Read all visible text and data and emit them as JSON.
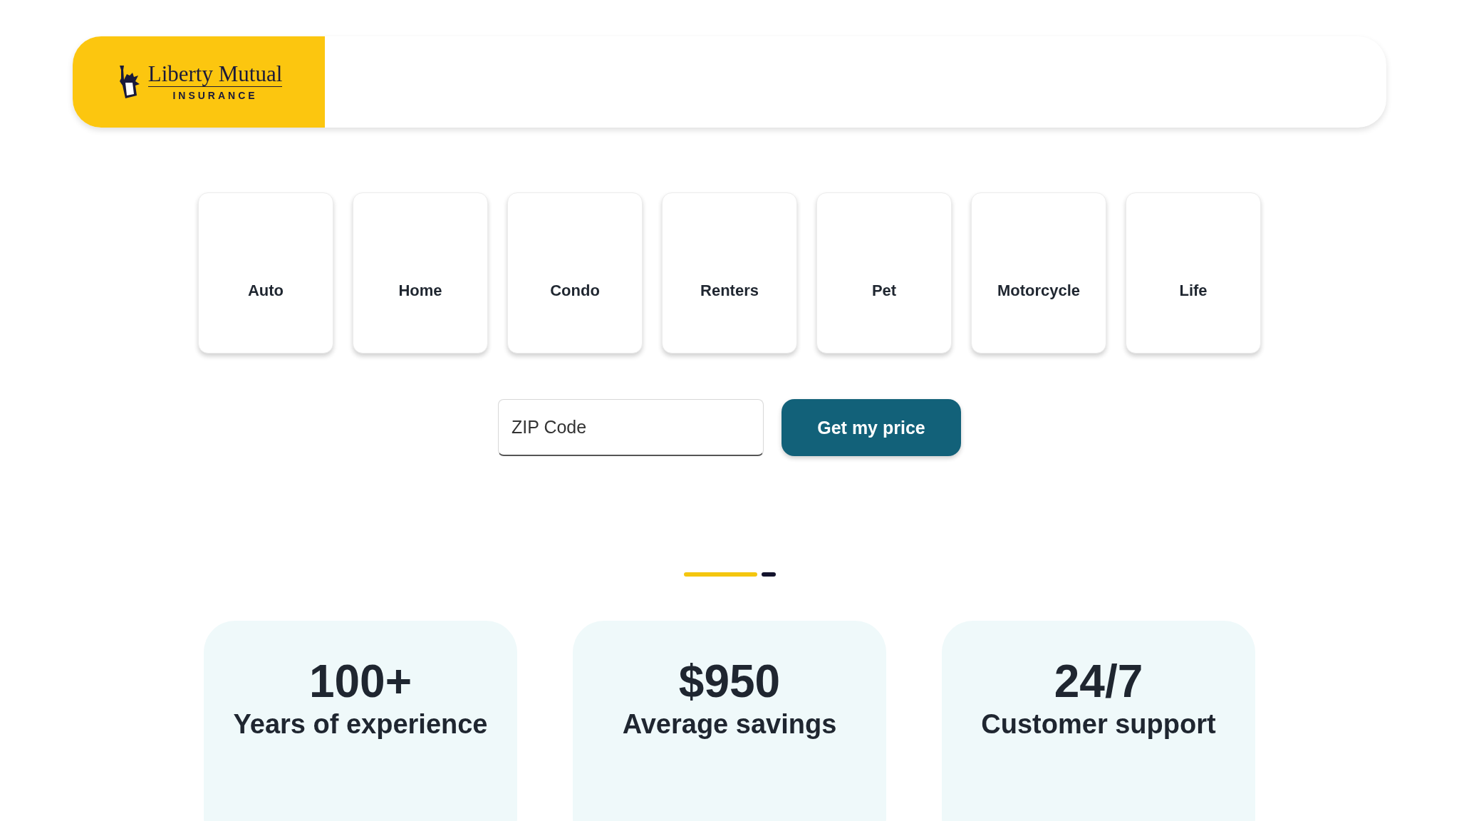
{
  "header": {
    "logo": {
      "name": "Liberty Mutual",
      "tagline": "INSURANCE"
    }
  },
  "products": [
    {
      "label": "Auto"
    },
    {
      "label": "Home"
    },
    {
      "label": "Condo"
    },
    {
      "label": "Renters"
    },
    {
      "label": "Pet"
    },
    {
      "label": "Motorcycle"
    },
    {
      "label": "Life"
    }
  ],
  "quote": {
    "zip_field": {
      "placeholder": "ZIP Code"
    },
    "button": "Get my price"
  },
  "pager": [
    {
      "selected": true
    },
    {
      "selected": false
    }
  ],
  "stats": [
    {
      "value": "100+",
      "label": "Years of experience"
    },
    {
      "value": "$950",
      "label": "Average savings"
    },
    {
      "value": "24/7",
      "label": "Customer support"
    }
  ]
}
